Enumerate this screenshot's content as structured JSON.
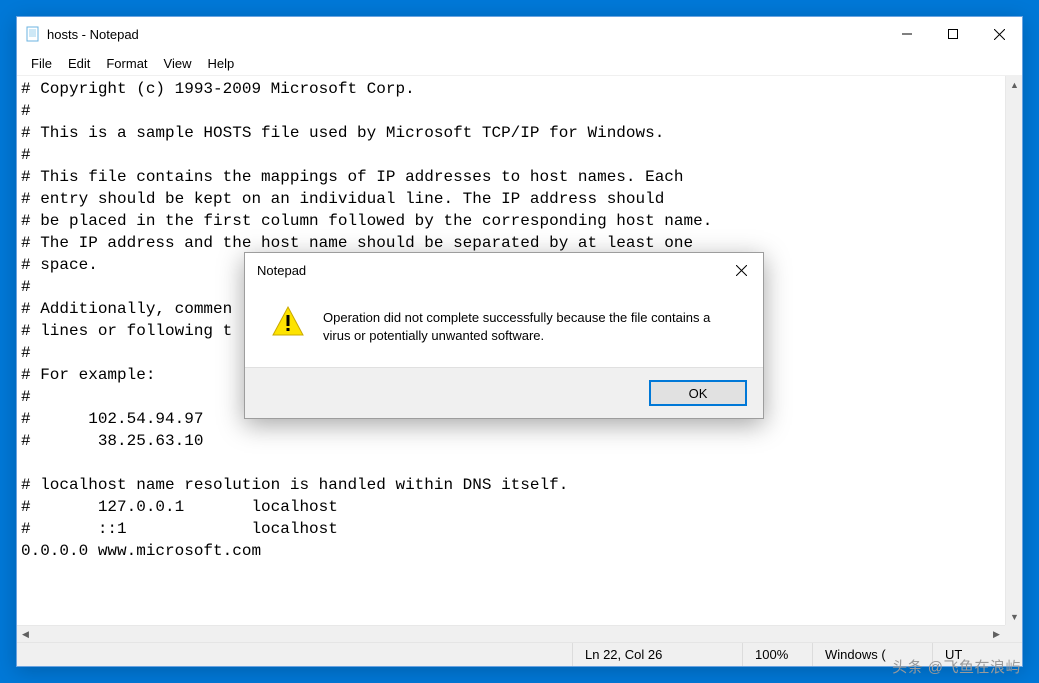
{
  "app": {
    "title": "hosts - Notepad"
  },
  "menu": {
    "file": "File",
    "edit": "Edit",
    "format": "Format",
    "view": "View",
    "help": "Help"
  },
  "document": {
    "text": "# Copyright (c) 1993-2009 Microsoft Corp.\n#\n# This is a sample HOSTS file used by Microsoft TCP/IP for Windows.\n#\n# This file contains the mappings of IP addresses to host names. Each\n# entry should be kept on an individual line. The IP address should\n# be placed in the first column followed by the corresponding host name.\n# The IP address and the host name should be separated by at least one\n# space.\n#\n# Additionally, commen\n# lines or following t\n#\n# For example:\n#\n#      102.54.94.97\n#       38.25.63.10\n\n# localhost name resolution is handled within DNS itself.\n#       127.0.0.1       localhost\n#       ::1             localhost\n0.0.0.0 www.microsoft.com"
  },
  "status": {
    "position": "Ln 22, Col 26",
    "zoom": "100%",
    "line_ending": "Windows (",
    "encoding": "UT"
  },
  "dialog": {
    "title": "Notepad",
    "message": "Operation did not complete successfully because the file contains a virus or potentially unwanted software.",
    "ok": "OK"
  },
  "watermark": "头条 @飞鱼在浪屿"
}
